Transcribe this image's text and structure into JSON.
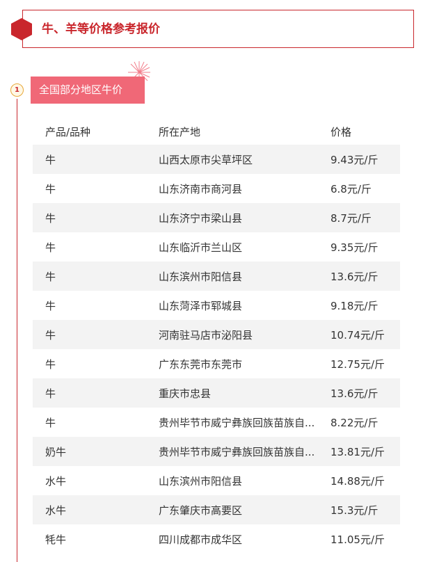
{
  "header": {
    "title": "牛、羊等价格参考报价"
  },
  "section": {
    "number": "1",
    "title": "全国部分地区牛价"
  },
  "table": {
    "columns": [
      "产品/品种",
      "所在产地",
      "价格"
    ],
    "rows": [
      [
        "牛",
        "山西太原市尖草坪区",
        "9.43元/斤"
      ],
      [
        "牛",
        "山东济南市商河县",
        "6.8元/斤"
      ],
      [
        "牛",
        "山东济宁市梁山县",
        "8.7元/斤"
      ],
      [
        "牛",
        "山东临沂市兰山区",
        "9.35元/斤"
      ],
      [
        "牛",
        "山东滨州市阳信县",
        "13.6元/斤"
      ],
      [
        "牛",
        "山东菏泽市郓城县",
        "9.18元/斤"
      ],
      [
        "牛",
        "河南驻马店市泌阳县",
        "10.74元/斤"
      ],
      [
        "牛",
        "广东东莞市东莞市",
        "12.75元/斤"
      ],
      [
        "牛",
        "重庆市忠县",
        "13.6元/斤"
      ],
      [
        "牛",
        "贵州毕节市威宁彝族回族苗族自...",
        "8.22元/斤"
      ],
      [
        "奶牛",
        "贵州毕节市威宁彝族回族苗族自...",
        "13.81元/斤"
      ],
      [
        "水牛",
        "山东滨州市阳信县",
        "14.88元/斤"
      ],
      [
        "水牛",
        "广东肇庆市高要区",
        "15.3元/斤"
      ],
      [
        "牦牛",
        "四川成都市成华区",
        "11.05元/斤"
      ]
    ]
  },
  "colors": {
    "accent": "#c9262c",
    "tag": "#f06877",
    "badge_border": "#e8a83a",
    "row_alt": "#f3f3f3"
  }
}
